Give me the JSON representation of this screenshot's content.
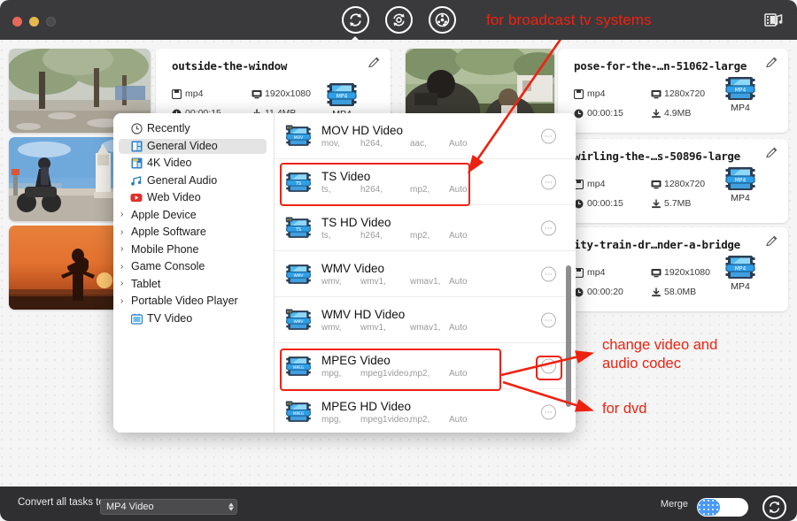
{
  "window": {
    "traffic_lights": [
      "close",
      "minimize",
      "zoom"
    ]
  },
  "toolbar": {
    "buttons": [
      {
        "name": "convert-tab",
        "icon": "convert-icon",
        "active": true
      },
      {
        "name": "toolbox-tab",
        "icon": "toolbox-icon",
        "active": false
      },
      {
        "name": "downloader-tab",
        "icon": "downloader-icon",
        "active": false
      }
    ],
    "right_icon": "media-library-icon"
  },
  "annotations": {
    "top": "for broadcast tv systems",
    "codec": "change video and\naudio codec",
    "codec_line1": "change video and",
    "codec_line2": "audio codec",
    "dvd": "for dvd"
  },
  "thumbnails": [
    {
      "name": "thumb-park",
      "alt": "tree-lined park path"
    },
    {
      "name": "thumb-motorcycle",
      "alt": "motorcycle rider by lighthouse"
    },
    {
      "name": "thumb-sunset",
      "alt": "silhouette at sunset"
    }
  ],
  "cards": [
    {
      "title": "outside-the-window",
      "container": "mp4",
      "resolution": "1920x1080",
      "duration": "00:00:15",
      "size": "11.4MB",
      "target_format": "MP4"
    },
    {
      "title": "pose-for-the-…n-51062-large",
      "container": "mp4",
      "resolution": "1280x720",
      "duration": "00:00:15",
      "size": "4.9MB",
      "target_format": "MP4"
    },
    {
      "title": "wirling-the-…s-50896-large",
      "container": "mp4",
      "resolution": "1280x720",
      "duration": "00:00:15",
      "size": "5.7MB",
      "target_format": "MP4"
    },
    {
      "title": "ity-train-dr…nder-a-bridge",
      "container": "mp4",
      "resolution": "1920x1080",
      "duration": "00:00:20",
      "size": "58.0MB",
      "target_format": "MP4"
    }
  ],
  "popup": {
    "categories": [
      {
        "label": "Recently",
        "icon": "clock-icon",
        "expandable": false,
        "selected": false
      },
      {
        "label": "General Video",
        "icon": "video-blue-icon",
        "expandable": false,
        "selected": true
      },
      {
        "label": "4K Video",
        "icon": "video-4k-icon",
        "expandable": false,
        "selected": false
      },
      {
        "label": "General Audio",
        "icon": "audio-note-icon",
        "expandable": false,
        "selected": false
      },
      {
        "label": "Web Video",
        "icon": "youtube-icon",
        "expandable": false,
        "selected": false
      },
      {
        "label": "Apple Device",
        "icon": "",
        "expandable": true,
        "selected": false
      },
      {
        "label": "Apple Software",
        "icon": "",
        "expandable": true,
        "selected": false
      },
      {
        "label": "Mobile Phone",
        "icon": "",
        "expandable": true,
        "selected": false
      },
      {
        "label": "Game Console",
        "icon": "",
        "expandable": true,
        "selected": false
      },
      {
        "label": "Tablet",
        "icon": "",
        "expandable": true,
        "selected": false
      },
      {
        "label": "Portable Video Player",
        "icon": "",
        "expandable": true,
        "selected": false
      },
      {
        "label": "TV Video",
        "icon": "tv-icon",
        "expandable": false,
        "selected": false
      }
    ],
    "formats": [
      {
        "name": "MOV HD Video",
        "ext": "mov,",
        "vcodec": "h264,",
        "acodec": "aac,",
        "quality": "Auto",
        "hd": true,
        "badge": "MOV",
        "highlighted": false
      },
      {
        "name": "TS Video",
        "ext": "ts,",
        "vcodec": "h264,",
        "acodec": "mp2,",
        "quality": "Auto",
        "hd": false,
        "badge": "TS",
        "highlighted": true
      },
      {
        "name": "TS HD Video",
        "ext": "ts,",
        "vcodec": "h264,",
        "acodec": "mp2,",
        "quality": "Auto",
        "hd": true,
        "badge": "TS",
        "highlighted": false
      },
      {
        "name": "WMV Video",
        "ext": "wmv,",
        "vcodec": "wmv1,",
        "acodec": "wmav1,",
        "quality": "Auto",
        "hd": false,
        "badge": "WMV",
        "highlighted": false
      },
      {
        "name": "WMV HD Video",
        "ext": "wmv,",
        "vcodec": "wmv1,",
        "acodec": "wmav1,",
        "quality": "Auto",
        "hd": true,
        "badge": "WMV",
        "highlighted": false
      },
      {
        "name": "MPEG Video",
        "ext": "mpg,",
        "vcodec": "mpeg1video,",
        "acodec": "mp2,",
        "quality": "Auto",
        "hd": false,
        "badge": "MPEG",
        "highlighted": true
      },
      {
        "name": "MPEG HD Video",
        "ext": "mpg,",
        "vcodec": "mpeg1video,",
        "acodec": "mp2,",
        "quality": "Auto",
        "hd": true,
        "badge": "MPEG",
        "highlighted": false
      }
    ]
  },
  "bottom": {
    "convert_all_label": "Convert all tasks to",
    "selected_format": "MP4 Video",
    "merge_label": "Merge",
    "merge_on": false,
    "convert_button": "convert-icon"
  },
  "colors": {
    "accent_red": "#ee2211",
    "titlebar": "#3a3a3c",
    "bottombar": "#2f2f31",
    "toggle_blue": "#4a9af5",
    "selected_row": "#e4e4e4"
  }
}
